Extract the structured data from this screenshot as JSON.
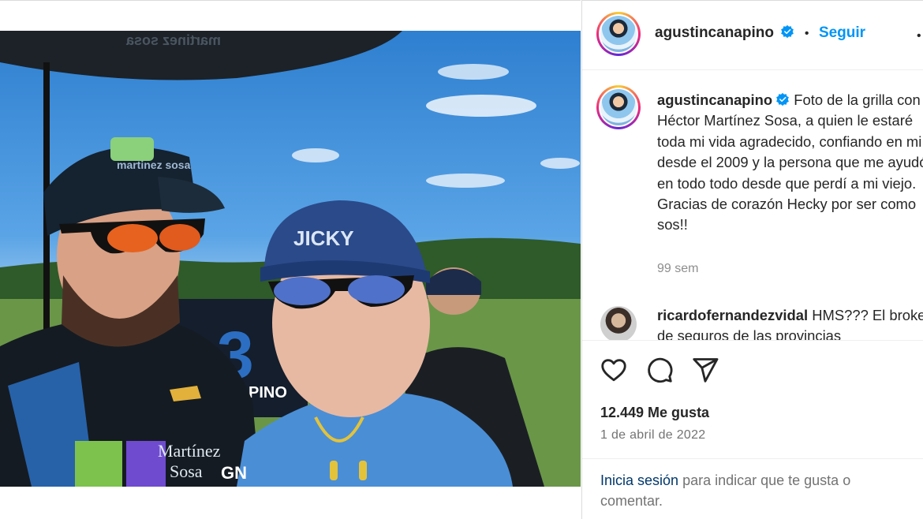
{
  "post": {
    "author": {
      "username": "agustincanapino",
      "verified": true,
      "follow_label": "Seguir",
      "separator": "•"
    },
    "photo": {
      "watermark": "GN",
      "cap_left_text": "martinez sosa",
      "cap_right_text": "JICKY",
      "car_number": "3",
      "banner_text": "PINO"
    },
    "caption": {
      "username": "agustincanapino",
      "text": "Foto de la grilla con Héctor Martínez Sosa, a quien le estaré toda mi vida agradecido, confiando en mi desde el 2009 y la persona que me ayudó en todo todo desde que perdí a mi viejo. Gracias de corazón Hecky por ser como sos!!",
      "time_ago": "99 sem"
    },
    "comments": [
      {
        "username": "ricardofernandezvidal",
        "text": "HMS??? El broker de seguros de las provincias"
      }
    ],
    "actions": {
      "like_icon": "heart-icon",
      "comment_icon": "comment-icon",
      "share_icon": "send-icon"
    },
    "likes_label": "12.449 Me gusta",
    "date": "1 de abril de 2022",
    "login_prompt": {
      "link": "Inicia sesión",
      "rest": " para indicar que te gusta o comentar."
    }
  },
  "colors": {
    "accent": "#0095f6",
    "verified": "#0095f6",
    "secondary_text": "#737373",
    "divider": "#dbdbdb"
  }
}
